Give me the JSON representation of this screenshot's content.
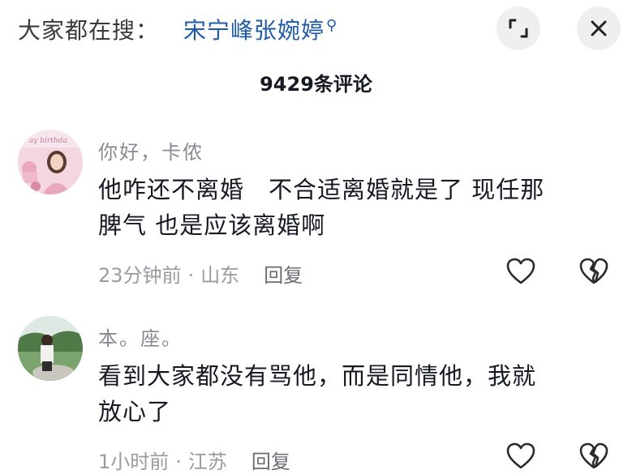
{
  "search": {
    "prefix": "大家都在搜：",
    "term": "宋宁峰张婉婷"
  },
  "header": {
    "comment_count": "9429条评论"
  },
  "comments": [
    {
      "username": "你好，卡侬",
      "text_line1": "他咋还不离婚　不合适离婚就是了 现任那",
      "text_line2": "脾气 也是应该离婚啊",
      "time": "23分钟前",
      "separator": "·",
      "location": "山东",
      "reply": "回复",
      "avatar_caption": "ay birthda"
    },
    {
      "username": "本。座。",
      "text_line1": "看到大家都没有骂他，而是同情他，我就",
      "text_line2": "放心了",
      "time": "1小时前",
      "separator": "·",
      "location": "江苏",
      "reply": "回复"
    }
  ],
  "colors": {
    "accent_link": "#1f5aa6",
    "text_primary": "#161823",
    "text_secondary": "#8a8b91",
    "button_bg": "#efefef"
  },
  "icons": [
    "search-icon",
    "expand-icon",
    "close-icon",
    "like-heart-icon",
    "dislike-broken-heart-icon"
  ]
}
